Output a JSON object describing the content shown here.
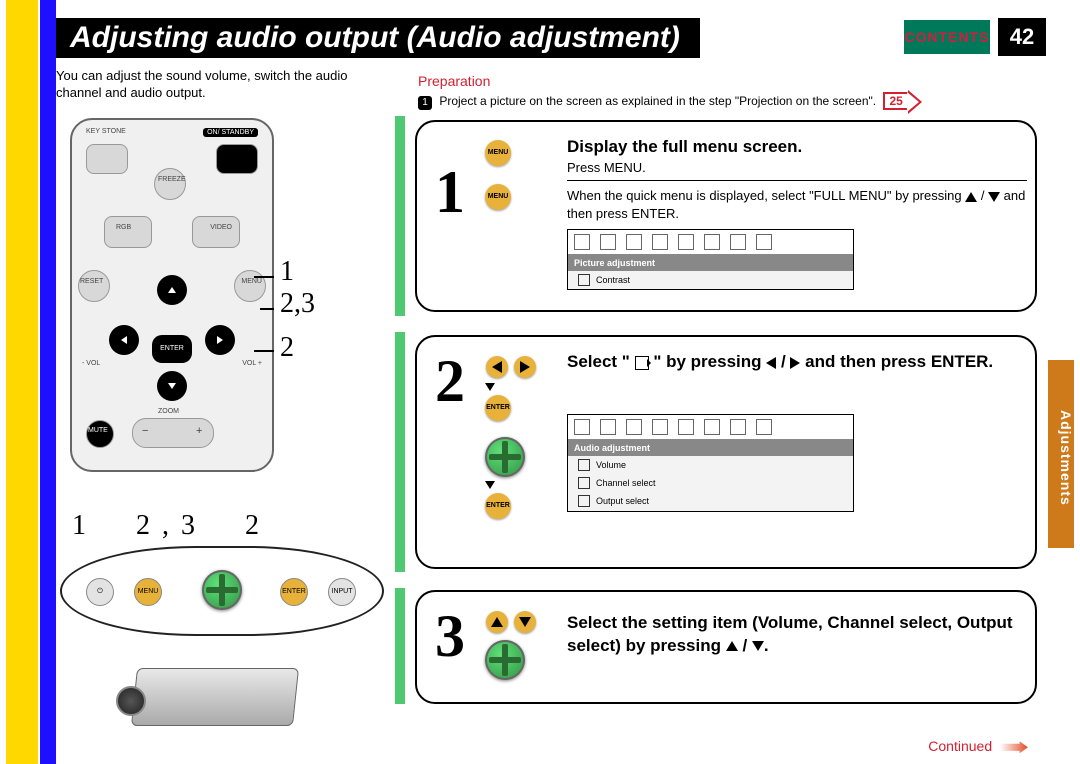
{
  "header": {
    "title": "Adjusting audio output (Audio adjustment)",
    "contents": "CONTENTS",
    "page": "42"
  },
  "intro": "You can adjust the sound volume, switch the audio channel and audio output.",
  "preparation": {
    "heading": "Preparation",
    "text": "Project a picture on the screen as explained in the step \"Projection on the screen\".",
    "ref": "25"
  },
  "steps": [
    {
      "num": "1",
      "btn": "MENU",
      "title": "Display the full menu screen.",
      "line1": "Press MENU.",
      "line2a": "When the quick menu is displayed, select \"FULL MENU\" by pressing ",
      "line2b": " and then press ENTER.",
      "menu": {
        "header": "Picture adjustment",
        "item": "Contrast"
      }
    },
    {
      "num": "2",
      "btnEnter": "ENTER",
      "title_a": "Select \" ",
      "title_b": " \" by pressing ",
      "title_c": " and then press ENTER.",
      "menu": {
        "header": "Audio adjustment",
        "items": [
          "Volume",
          "Channel select",
          "Output select"
        ]
      }
    },
    {
      "num": "3",
      "title_a": "Select the setting item (Volume, Channel select, Output select) by pressing "
    }
  ],
  "remote": {
    "labels": {
      "keystone": "KEY\nSTONE",
      "standby": "ON/\nSTANDBY",
      "freeze": "FREEZE",
      "rgb": "RGB",
      "video": "VIDEO",
      "reset": "RESET",
      "menu": "MENU",
      "enter": "ENTER",
      "volminus": "- VOL",
      "volplus": "VOL +",
      "zoom": "ZOOM",
      "mute": "MUTE"
    },
    "callouts": [
      "1",
      "2,3",
      "2"
    ]
  },
  "panel": {
    "callouts": [
      "1",
      "2,3",
      "2"
    ],
    "labels": {
      "menu": "MENU",
      "enter": "ENTER",
      "input": "INPUT"
    }
  },
  "side_tab": "Adjustments",
  "continued": "Continued"
}
